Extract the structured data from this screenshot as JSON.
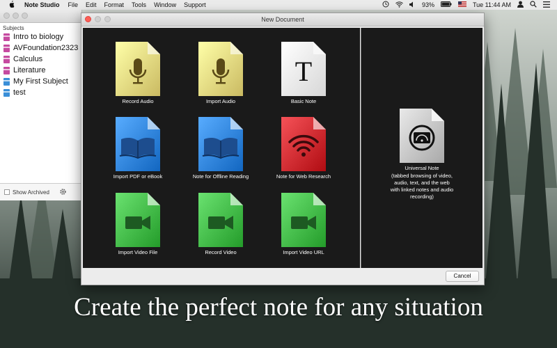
{
  "menubar": {
    "app_name": "Note Studio",
    "menus": [
      "File",
      "Edit",
      "Format",
      "Tools",
      "Window",
      "Support"
    ],
    "battery": "93%",
    "clock": "Tue 11:44 AM"
  },
  "subjects": {
    "header": "Subjects",
    "items": [
      {
        "label": "Intro to biology",
        "color": "#c64aa0"
      },
      {
        "label": "AVFoundation2323",
        "color": "#c64aa0"
      },
      {
        "label": "Calculus",
        "color": "#c64aa0"
      },
      {
        "label": "Literature",
        "color": "#c64aa0"
      },
      {
        "label": "My First Subject",
        "color": "#3a8fd8"
      },
      {
        "label": "test",
        "color": "#3a8fd8"
      }
    ],
    "show_archived": "Show Archived"
  },
  "dialog": {
    "title": "New Document",
    "tiles": [
      {
        "label": "Record Audio",
        "kind": "mic",
        "color": "#f2e28a"
      },
      {
        "label": "Import Audio",
        "kind": "mic",
        "color": "#f2e28a"
      },
      {
        "label": "Basic Note",
        "kind": "text",
        "color": "#ffffff"
      },
      {
        "label": "Import PDF or eBook",
        "kind": "book",
        "color": "#3a8ee8"
      },
      {
        "label": "Note for Offline Reading",
        "kind": "book",
        "color": "#3a8ee8"
      },
      {
        "label": "Note for Web Research",
        "kind": "wifi",
        "color": "#d8343a"
      },
      {
        "label": "Import Video File",
        "kind": "video",
        "color": "#4cc452"
      },
      {
        "label": "Record Video",
        "kind": "video",
        "color": "#4cc452"
      },
      {
        "label": "Import Video URL",
        "kind": "video",
        "color": "#4cc452"
      }
    ],
    "universal": {
      "label": "Universal Note",
      "description": "(tabbed browsing of video, audio, text, and the web with linked notes and audio recording)"
    },
    "cancel_label": "Cancel"
  },
  "caption": "Create the perfect note for any situation"
}
